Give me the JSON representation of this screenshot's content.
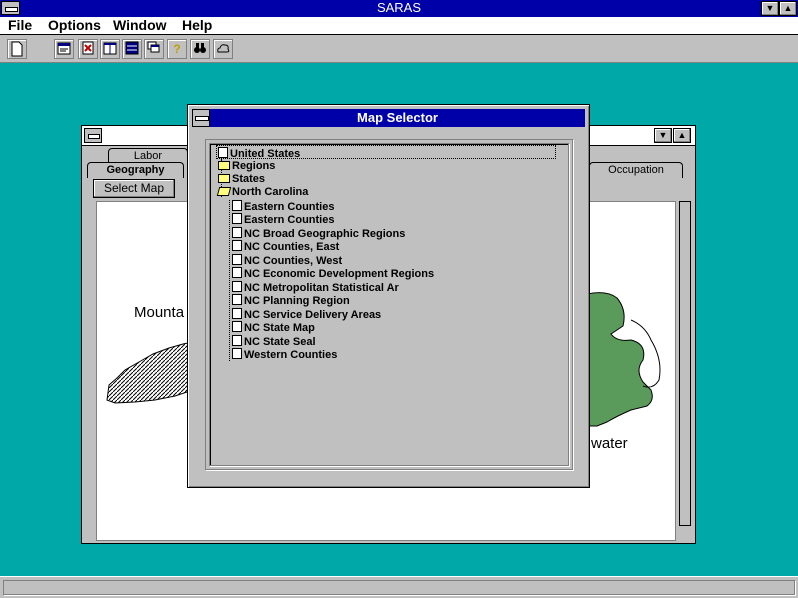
{
  "app": {
    "title": "SARAS"
  },
  "menu": [
    "File",
    "Options",
    "Window",
    "Help"
  ],
  "toolbar": {
    "icons": [
      "new-document-icon",
      "properties-icon",
      "report-icon",
      "columns-icon",
      "list-icon",
      "cascade-icon",
      "help-icon",
      "find-icon",
      "cloud-icon"
    ]
  },
  "child_window": {
    "tabs_back": [
      "Labor"
    ],
    "tabs_front": [
      "Geography",
      "Occupation"
    ],
    "select_map_label": "Select Map",
    "map_labels": {
      "left": "Mounta",
      "right": "water"
    }
  },
  "dialog": {
    "title": "Map Selector",
    "tree": {
      "root": "United States",
      "folders": [
        "Regions",
        "States"
      ],
      "open_folder": "North Carolina",
      "items": [
        "Eastern Counties",
        "Eastern Counties",
        "NC Broad Geographic Regions",
        "NC Counties, East",
        "NC Counties, West",
        "NC Economic Development Regions",
        "NC Metropolitan Statistical Ar",
        "NC Planning Region",
        "NC Service Delivery Areas",
        "NC State Map",
        "NC State Seal",
        "Western Counties"
      ]
    }
  },
  "colors": {
    "desktop": "#00a8a8",
    "titlebar": "#0000a8",
    "face": "#c0c0c0",
    "map_green": "#5a9a5a"
  }
}
